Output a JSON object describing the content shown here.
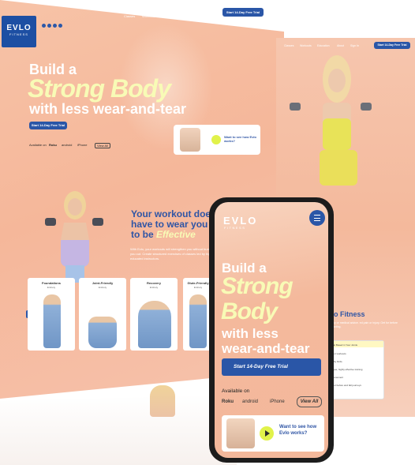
{
  "desktop": {
    "logo": {
      "main": "EVLO",
      "sub": "FITNESS"
    },
    "menu": [
      "Classes",
      "Workouts",
      "Corporate",
      "About",
      "Sign In"
    ],
    "cta_top": "Start 14-Day Free Trial",
    "hero": {
      "line1": "Build a",
      "line2": "Strong Body",
      "line3": "with less wear-and-tear"
    },
    "hero_cta": "Start 14-Day Free Trial",
    "available": [
      "Available on",
      "Roku",
      "android",
      "iPhone",
      "View All"
    ],
    "video_card": {
      "text": "Want to see how Evlo works?"
    },
    "section2": {
      "heading_l1": "Your workout doesn't",
      "heading_l2": "have to wear you down",
      "heading_l3a": "to be",
      "heading_l3b": "Effective",
      "para": "With Evlo, your workouts will strengthen you without burning you out. Create structured exercises of classes led by highly educated instructors."
    },
    "cards": [
      {
        "title": "Foundations",
        "sub": "Entirety"
      },
      {
        "title": "Joint-Friendly",
        "sub": "Entirety"
      },
      {
        "title": "Recovery",
        "sub": "Entirety"
      },
      {
        "title": "Glute-Friendly",
        "sub": "Entirety"
      }
    ],
    "prev_arrow": "‹"
  },
  "middle": {
    "menu": [
      "Classes",
      "Workouts",
      "Education",
      "About",
      "Sign In"
    ],
    "cta": "Start 14-Day Free Trial",
    "fitness_title": "o Fitness",
    "fitness_para": "apy or medical advice. ed pain or injury. Get for before starting.",
    "panel_rows": [
      "that Based in Your Joints",
      "your workouts",
      "ly by birds.",
      "nique, highly effective training",
      "attunement",
      "your before and fall journeys"
    ]
  },
  "phone": {
    "logo": {
      "main": "EVLO",
      "sub": "FITNESS"
    },
    "hero": {
      "line1": "Build a",
      "line2a": "Strong",
      "line2b": "Body",
      "line3": "with less",
      "line4": "wear-and-tear"
    },
    "cta": "Start 14-Day Free Trial",
    "available_label": "Available on",
    "platforms": [
      "Roku",
      "android",
      "iPhone"
    ],
    "view_all": "View All",
    "video_text": "Want to see how Evlo works?"
  },
  "colors": {
    "peach": "#f5b79a",
    "blue": "#2a56a7",
    "yellow": "#f8fbb6",
    "accent": "#e1f24a"
  }
}
